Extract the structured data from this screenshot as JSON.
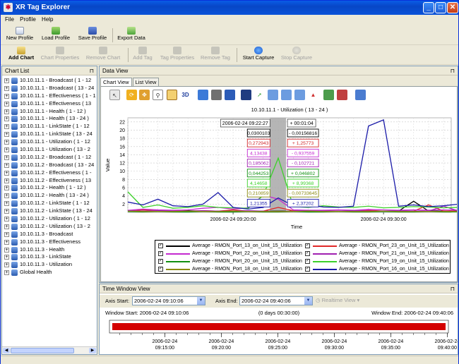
{
  "window": {
    "title": "XR Tag Explorer",
    "minimize": "_",
    "maximize": "□",
    "close": "✕"
  },
  "menu": [
    "File",
    "Profile",
    "Help"
  ],
  "toolbar1": [
    {
      "label": "New Profile",
      "icon": "new-profile-icon",
      "enabled": true
    },
    {
      "label": "Load Profile",
      "icon": "load-profile-icon",
      "enabled": true
    },
    {
      "label": "Save Profile",
      "icon": "save-profile-icon",
      "enabled": true
    },
    {
      "label": "Export Data",
      "icon": "export-data-icon",
      "enabled": true
    }
  ],
  "toolbar2": [
    {
      "label": "Add Chart",
      "icon": "add-chart-icon",
      "enabled": true
    },
    {
      "label": "Chart Properties",
      "icon": "chart-properties-icon",
      "enabled": false
    },
    {
      "label": "Remove Chart",
      "icon": "remove-chart-icon",
      "enabled": false
    },
    {
      "label": "Add Tag",
      "icon": "add-tag-icon",
      "enabled": false
    },
    {
      "label": "Tag Properties",
      "icon": "tag-properties-icon",
      "enabled": false
    },
    {
      "label": "Remove Tag",
      "icon": "remove-tag-icon",
      "enabled": false
    },
    {
      "label": "Start Capture",
      "icon": "start-capture-icon",
      "enabled": true
    },
    {
      "label": "Stop Capture",
      "icon": "stop-capture-icon",
      "enabled": false
    }
  ],
  "chart_list": {
    "title": "Chart List",
    "pin": "⊓",
    "items": [
      "10.10.11.1 - Broadcast ( 1 - 12",
      "10.10.11.1 - Broadcast ( 13 - 24",
      "10.10.11.1 - Effectiveness ( 1 - 1",
      "10.10.11.1 - Effectiveness ( 13",
      "10.10.11.1 - Health ( 1 - 12 )",
      "10.10.11.1 - Health ( 13 - 24 )",
      "10.10.11.1 - LinkState ( 1 - 12",
      "10.10.11.1 - LinkState ( 13 - 24",
      "10.10.11.1 - Utilization ( 1 - 12",
      "10.10.11.1 - Utilization ( 13 - 2",
      "10.10.11.2 - Broadcast ( 1 - 12",
      "10.10.11.2 - Broadcast ( 13 - 24",
      "10.10.11.2 - Effectiveness ( 1 -",
      "10.10.11.2 - Effectiveness ( 13",
      "10.10.11.2 - Health ( 1 - 12 )",
      "10.10.11.2 - Health ( 13 - 24 )",
      "10.10.11.2 - LinkState ( 1 - 12",
      "10.10.11.2 - LinkState ( 13 - 24",
      "10.10.11.2 - Utilization ( 1 - 12",
      "10.10.11.2 - Utilization ( 13 - 2",
      "10.10.11.3 - Broadcast",
      "10.10.11.3 - Effectiveness",
      "10.10.11.3 - Health",
      "10.10.11.3 - LinkState",
      "10.10.11.3 - Utilization",
      "Global Health"
    ]
  },
  "data_view": {
    "title": "Data View",
    "pin": "⊓",
    "tabs": [
      "Chart View",
      "List View"
    ],
    "chart_toolbar_3d": "3D"
  },
  "chart_data": {
    "type": "line",
    "title": "10.10.11.1 - Utilization ( 13 - 24 )",
    "xlabel": "Time",
    "ylabel": "Value",
    "ylim": [
      0,
      23
    ],
    "yticks": [
      2,
      4,
      6,
      8,
      10,
      12,
      14,
      16,
      18,
      20,
      22
    ],
    "x_start": "2006-02-24 09:13:00",
    "x_end": "2006-02-24 09:34:30",
    "xticks": [
      {
        "label": "2006-02-24 09:20:00",
        "t": 7
      },
      {
        "label": "2006-02-24 09:30:00",
        "t": 17
      }
    ],
    "grid": true,
    "cursor": {
      "time_label": "2006-02-24 09:22:27",
      "delta_label": "+ 00:01:04",
      "t_start": 9.45,
      "t_end": 10.52,
      "left_values": [
        "0,0300103",
        "0,272943",
        "4,13438",
        "0,185062",
        "0,044253",
        "4,14658",
        "0,210859",
        "1,21355"
      ],
      "right_values": [
        "- 0,00156816",
        "+ 1,25773",
        "- 0,937559",
        "- 0,102721",
        "+ 0,046802",
        "+ 8,99368",
        "- 0,00733645",
        "+ 2,37202"
      ],
      "colors": [
        "#000000",
        "#d0272b",
        "#c42ad0",
        "#a020b0",
        "#109010",
        "#3cd02a",
        "#8a8a10",
        "#1a1aa8"
      ]
    },
    "series": [
      {
        "name": "Average - RMON_Port_13_on_Unit_15_Utilization",
        "color": "#000000",
        "x": [
          0,
          1,
          2,
          3,
          4,
          5,
          6,
          7,
          8,
          9,
          10,
          11,
          12,
          13,
          14,
          15,
          16,
          17,
          18,
          19,
          20,
          21,
          22
        ],
        "y": [
          0.3,
          0.3,
          0.3,
          0.3,
          0.4,
          0.3,
          0.3,
          0.3,
          0.3,
          0.3,
          0.3,
          0.3,
          0.3,
          0.3,
          0.3,
          0.3,
          0.3,
          0.3,
          0.3,
          2.7,
          0.3,
          0.3,
          0.3
        ]
      },
      {
        "name": "Average - RMON_Port_23_on_Unit_15_Utilization",
        "color": "#e02828",
        "x": [
          0,
          1,
          2,
          3,
          4,
          5,
          6,
          7,
          8,
          9,
          10,
          11,
          12,
          13,
          14,
          15,
          16,
          17,
          18,
          19,
          20,
          21,
          22
        ],
        "y": [
          0.3,
          0.6,
          0.4,
          0.3,
          0.3,
          0.4,
          0.3,
          0.6,
          0.3,
          0.3,
          1.2,
          0.4,
          0.3,
          0.3,
          0.3,
          0.3,
          0.5,
          0.3,
          0.3,
          0.3,
          1.8,
          0.3,
          0.4
        ]
      },
      {
        "name": "Average - RMON_Port_22_on_Unit_15_Utilization",
        "color": "#c42ad0",
        "x": [
          0,
          1,
          2,
          3,
          4,
          5,
          6,
          7,
          8,
          9,
          10,
          11,
          12,
          13,
          14,
          15,
          16,
          17,
          18,
          19,
          20,
          21,
          22
        ],
        "y": [
          0.5,
          0.8,
          0.6,
          0.5,
          0.6,
          1.0,
          1.2,
          0.8,
          1.1,
          4.2,
          3.2,
          0.6,
          0.5,
          0.5,
          0.6,
          0.5,
          0.7,
          0.6,
          0.5,
          0.6,
          0.5,
          0.6,
          0.5
        ]
      },
      {
        "name": "Average - RMON_Port_21_on_Unit_15_Utilization",
        "color": "#a020b0",
        "x": [
          0,
          1,
          2,
          3,
          4,
          5,
          6,
          7,
          8,
          9,
          10,
          11,
          12,
          13,
          14,
          15,
          16,
          17,
          18,
          19,
          20,
          21,
          22
        ],
        "y": [
          0.4,
          0.3,
          0.4,
          0.3,
          0.3,
          0.4,
          0.3,
          0.3,
          0.4,
          0.3,
          0.2,
          0.3,
          0.4,
          0.3,
          0.3,
          0.4,
          0.3,
          0.3,
          0.4,
          0.3,
          0.3,
          1.5,
          0.3
        ]
      },
      {
        "name": "Average - RMON_Port_20_on_Unit_15_Utilization",
        "color": "#109010",
        "x": [
          0,
          1,
          2,
          3,
          4,
          5,
          6,
          7,
          8,
          9,
          10,
          11,
          12,
          13,
          14,
          15,
          16,
          17,
          18,
          19,
          20,
          21,
          22
        ],
        "y": [
          0.2,
          0.1,
          0.2,
          0.1,
          0.1,
          0.2,
          0.1,
          0.1,
          0.2,
          0.1,
          0.1,
          0.2,
          0.1,
          0.1,
          0.2,
          0.1,
          0.1,
          0.2,
          0.1,
          0.1,
          0.2,
          0.1,
          0.1
        ]
      },
      {
        "name": "Average - RMON_Port_19_on_Unit_15_Utilization",
        "color": "#3cd02a",
        "x": [
          0,
          1,
          2,
          3,
          4,
          5,
          6,
          7,
          8,
          9,
          10,
          11,
          12,
          13,
          14,
          15,
          16,
          17,
          18,
          19,
          20,
          21,
          22
        ],
        "y": [
          5.0,
          1.2,
          1.8,
          1.0,
          1.2,
          1.6,
          1.2,
          1.1,
          1.0,
          4.1,
          13.2,
          1.4,
          1.2,
          1.6,
          1.3,
          1.2,
          1.5,
          1.1,
          1.2,
          1.4,
          1.3,
          1.1,
          1.2
        ]
      },
      {
        "name": "Average - RMON_Port_18_on_Unit_15_Utilization",
        "color": "#8a8a10",
        "x": [
          0,
          1,
          2,
          3,
          4,
          5,
          6,
          7,
          8,
          9,
          10,
          11,
          12,
          13,
          14,
          15,
          16,
          17,
          18,
          19,
          20,
          21,
          22
        ],
        "y": [
          0.3,
          0.2,
          0.2,
          0.2,
          0.3,
          0.2,
          0.2,
          0.3,
          0.2,
          0.2,
          0.2,
          0.2,
          0.3,
          0.2,
          0.2,
          0.2,
          0.2,
          0.3,
          0.2,
          0.2,
          0.2,
          0.2,
          0.2
        ]
      },
      {
        "name": "Average - RMON_Port_16_on_Unit_15_Utilization",
        "color": "#1a1aa8",
        "x": [
          0,
          1,
          2,
          3,
          4,
          5,
          6,
          7,
          8,
          9,
          10,
          11,
          12,
          13,
          14,
          15,
          16,
          17,
          18,
          19,
          20,
          21,
          22
        ],
        "y": [
          2.5,
          1.8,
          3.2,
          1.6,
          1.4,
          2.0,
          4.8,
          1.2,
          0.8,
          1.2,
          3.5,
          1.6,
          1.8,
          1.3,
          1.2,
          1.5,
          21.0,
          22.5,
          1.5,
          1.8,
          1.4,
          1.6,
          2.0
        ]
      }
    ]
  },
  "time_window": {
    "title": "Time Window View",
    "pin": "⊓",
    "axis_start_label": "Axis Start:",
    "axis_start_value": "2006-02-24 09:10:06",
    "axis_end_label": "Axis End:",
    "axis_end_value": "2006-02-24 09:40:06",
    "realtime_label": "Realtime View",
    "window_start": "Window Start: 2006-02-24 09:10:06",
    "duration": "(0 days 00:30:00)",
    "window_end": "Window End: 2006-02-24 09:40:06",
    "bar_color": "#d40000",
    "ticks": [
      {
        "date": "2006-02-24",
        "time": "09:15:00"
      },
      {
        "date": "2006-02-24",
        "time": "09:20:00"
      },
      {
        "date": "2006-02-24",
        "time": "09:25:00"
      },
      {
        "date": "2006-02-24",
        "time": "09:30:00"
      },
      {
        "date": "2006-02-24",
        "time": "09:35:00"
      },
      {
        "date": "2006-02-24",
        "time": "09:40:00"
      }
    ]
  }
}
